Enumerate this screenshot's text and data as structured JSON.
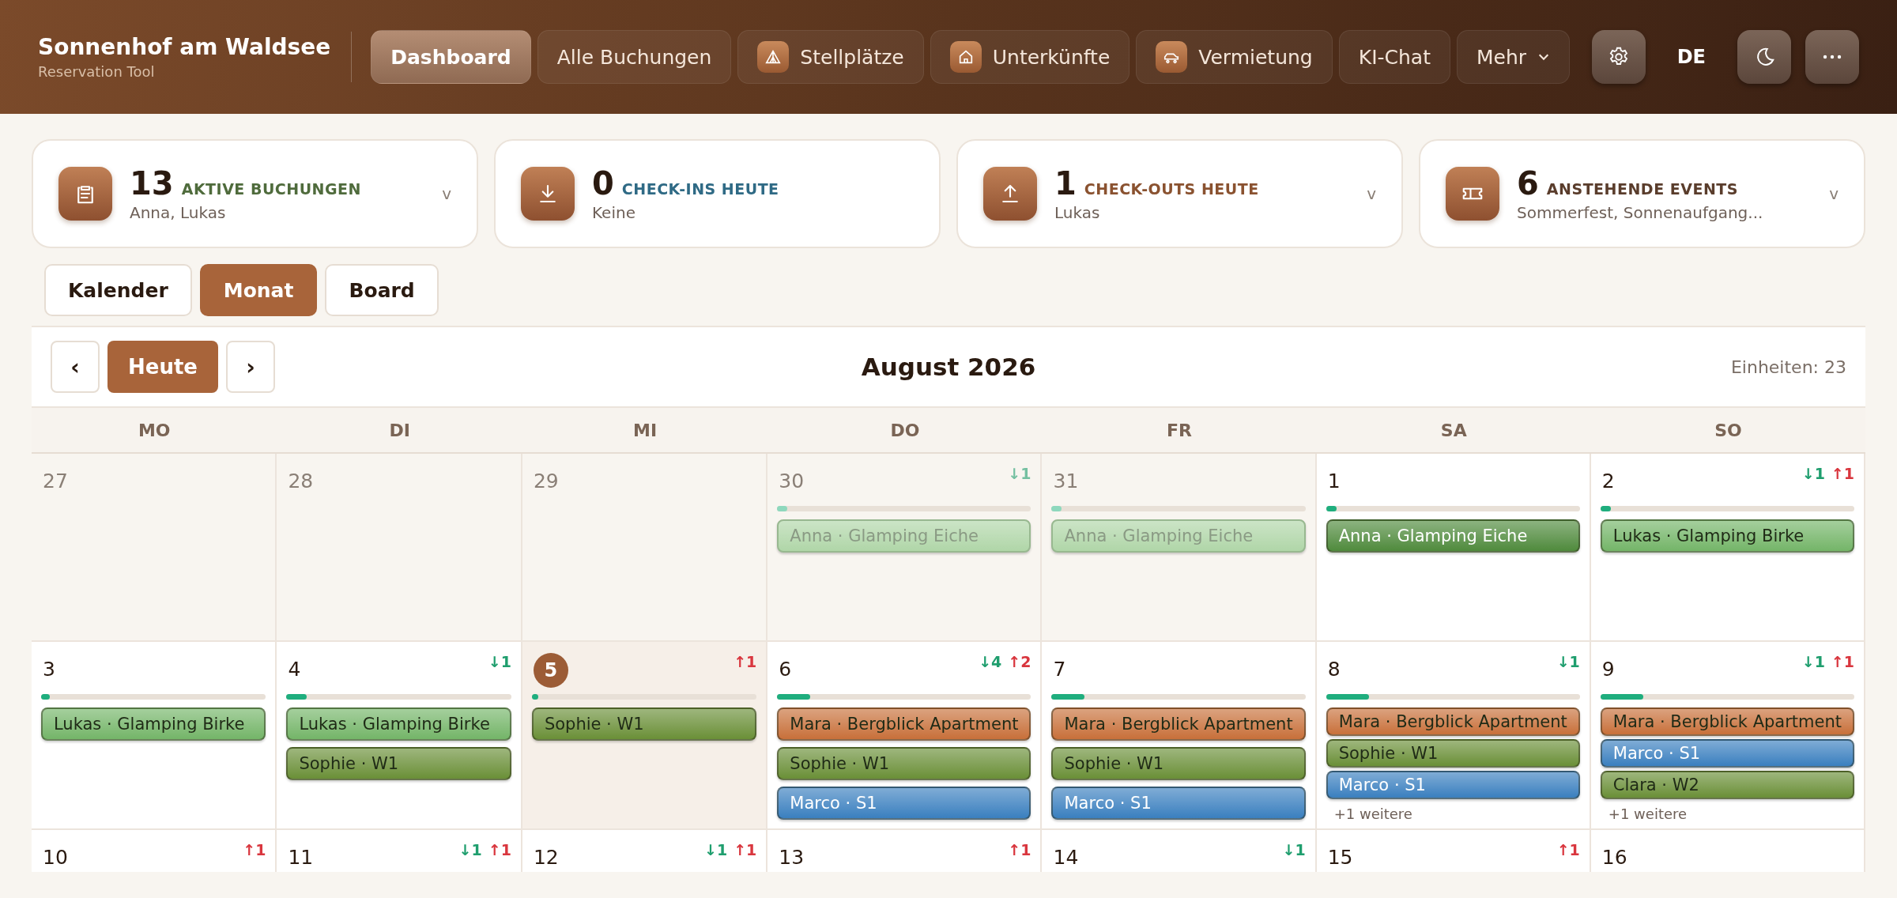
{
  "brand": {
    "title": "Sonnenhof am Waldsee",
    "subtitle": "Reservation Tool"
  },
  "nav": [
    {
      "label": "Dashboard",
      "kind": "plain",
      "selected": true
    },
    {
      "label": "Alle Buchungen",
      "kind": "plain",
      "selected": false
    },
    {
      "label": "Stellplätze",
      "kind": "tent",
      "selected": false
    },
    {
      "label": "Unterkünfte",
      "kind": "house",
      "selected": false
    },
    {
      "label": "Vermietung",
      "kind": "car",
      "selected": false
    },
    {
      "label": "KI-Chat",
      "kind": "plain",
      "selected": false
    },
    {
      "label": "Mehr",
      "kind": "menu",
      "selected": false
    }
  ],
  "language": "DE",
  "stats": [
    {
      "kind": "clipboard",
      "count": "13",
      "label": "AKTIVE BUCHUNGEN",
      "color": "#4f6b3c",
      "detail": "Anna, Lukas",
      "toggle": "v"
    },
    {
      "kind": "download",
      "count": "0",
      "label": "CHECK-INS HEUTE",
      "color": "#2f6a85",
      "detail": "Keine"
    },
    {
      "kind": "upload",
      "count": "1",
      "label": "CHECK-OUTS HEUTE",
      "color": "#8a5230",
      "detail": "Lukas",
      "toggle": "v"
    },
    {
      "kind": "ticket",
      "count": "6",
      "label": "ANSTEHENDE EVENTS",
      "color": "#5a3d2c",
      "detail": "Sommerfest, Sonnenaufgang...",
      "toggle": "v"
    }
  ],
  "views": [
    {
      "label": "Kalender",
      "selected": false
    },
    {
      "label": "Monat",
      "selected": true
    },
    {
      "label": "Board",
      "selected": false
    }
  ],
  "calendar": {
    "prev": "‹",
    "today": "Heute",
    "next": "›",
    "title": "August 2026",
    "units": "Einheiten: 23",
    "weekdays": [
      "MO",
      "DI",
      "MI",
      "DO",
      "FR",
      "SA",
      "SO"
    ],
    "weeks": [
      [
        {
          "date": "27",
          "outside": true,
          "today": false
        },
        {
          "date": "28",
          "outside": true,
          "today": false
        },
        {
          "date": "29",
          "outside": true,
          "today": false
        },
        {
          "date": "30",
          "outside": true,
          "today": false,
          "arrivals": "↓1",
          "level": 0.04,
          "bookings": [
            {
              "label": "Anna · Glamping Eiche",
              "color": "#b0d6a8"
            }
          ]
        },
        {
          "date": "31",
          "outside": true,
          "today": false,
          "level": 0.04,
          "bookings": [
            {
              "label": "Anna · Glamping Eiche",
              "color": "#b0d6a8"
            }
          ]
        },
        {
          "date": "1",
          "outside": false,
          "today": false,
          "level": 0.04,
          "bookings": [
            {
              "label": "Anna · Glamping Eiche",
              "color": "#4f8a3c"
            }
          ]
        },
        {
          "date": "2",
          "outside": false,
          "today": false,
          "arrivals": "↓1",
          "departures": "↑1",
          "level": 0.04,
          "bookings": [
            {
              "label": "Lukas · Glamping Birke",
              "color": "#74b568"
            }
          ]
        }
      ],
      [
        {
          "date": "3",
          "outside": false,
          "today": false,
          "level": 0.04,
          "bookings": [
            {
              "label": "Lukas · Glamping Birke",
              "color": "#74b568"
            }
          ]
        },
        {
          "date": "4",
          "outside": false,
          "today": false,
          "arrivals": "↓1",
          "level": 0.09,
          "bookings": [
            {
              "label": "Lukas · Glamping Birke",
              "color": "#74b568"
            },
            {
              "label": "Sophie · W1",
              "color": "#6a8f37"
            }
          ]
        },
        {
          "date": "5",
          "outside": false,
          "today": true,
          "departures": "↑1",
          "level": 0.03,
          "bookings": [
            {
              "label": "Sophie · W1",
              "color": "#6a8f37"
            }
          ]
        },
        {
          "date": "6",
          "outside": false,
          "today": false,
          "arrivals": "↓4",
          "departures": "↑2",
          "level": 0.13,
          "bookings": [
            {
              "label": "Mara · Bergblick Apartment",
              "color": "#c8703a"
            },
            {
              "label": "Sophie · W1",
              "color": "#6a8f37"
            },
            {
              "label": "Marco · S1",
              "color": "#3a7fbf"
            }
          ]
        },
        {
          "date": "7",
          "outside": false,
          "today": false,
          "level": 0.13,
          "bookings": [
            {
              "label": "Mara · Bergblick Apartment",
              "color": "#c8703a"
            },
            {
              "label": "Sophie · W1",
              "color": "#6a8f37"
            },
            {
              "label": "Marco · S1",
              "color": "#3a7fbf"
            }
          ]
        },
        {
          "date": "8",
          "outside": false,
          "today": false,
          "arrivals": "↓1",
          "level": 0.17,
          "bookings": [
            {
              "label": "Mara · Bergblick Apartment",
              "color": "#c8703a"
            },
            {
              "label": "Sophie · W1",
              "color": "#6a8f37"
            },
            {
              "label": "Marco · S1",
              "color": "#3a7fbf"
            }
          ],
          "more": "+1 weitere"
        },
        {
          "date": "9",
          "outside": false,
          "today": false,
          "arrivals": "↓1",
          "departures": "↑1",
          "level": 0.17,
          "bookings": [
            {
              "label": "Mara · Bergblick Apartment",
              "color": "#c8703a"
            },
            {
              "label": "Marco · S1",
              "color": "#3a7fbf"
            },
            {
              "label": "Clara · W2",
              "color": "#6a8f37"
            }
          ],
          "more": "+1 weitere"
        }
      ],
      [
        {
          "date": "10",
          "outside": false,
          "today": false,
          "departures": "↑1"
        },
        {
          "date": "11",
          "outside": false,
          "today": false,
          "arrivals": "↓1",
          "departures": "↑1"
        },
        {
          "date": "12",
          "outside": false,
          "today": false,
          "arrivals": "↓1",
          "departures": "↑1"
        },
        {
          "date": "13",
          "outside": false,
          "today": false,
          "departures": "↑1"
        },
        {
          "date": "14",
          "outside": false,
          "today": false,
          "arrivals": "↓1"
        },
        {
          "date": "15",
          "outside": false,
          "today": false,
          "departures": "↑1"
        },
        {
          "date": "16",
          "outside": false,
          "today": false
        }
      ]
    ]
  }
}
